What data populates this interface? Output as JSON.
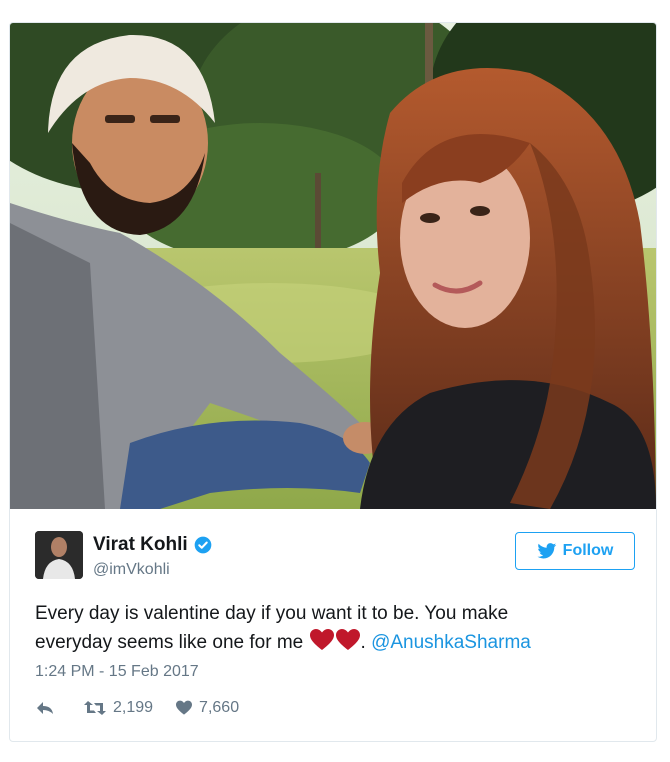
{
  "tweet": {
    "display_name": "Virat Kohli",
    "handle": "@imVkohli",
    "follow_label": "Follow",
    "text_line1": "Every day is valentine day if you want it to be. You make",
    "text_line2_start": "everyday seems like one for me",
    "text_separator": ". ",
    "mention": "@AnushkaSharma",
    "timestamp": "1:24 PM - 15 Feb 2017",
    "retweet_count": "2,199",
    "like_count": "7,660"
  },
  "colors": {
    "accent": "#1da1f2",
    "mention": "#1b95e0",
    "secondary_text": "#657786",
    "heart": "#c0182b"
  },
  "icons": [
    "verified-badge-icon",
    "twitter-bird-icon",
    "reply-icon",
    "retweet-icon",
    "like-heart-icon",
    "red-heart-emoji"
  ]
}
